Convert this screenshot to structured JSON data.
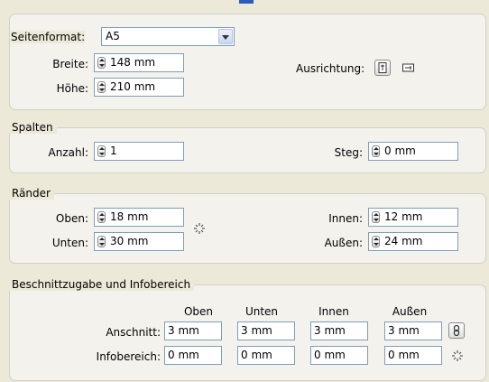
{
  "page_size": {
    "label": "Seitenformat:",
    "value": "A5"
  },
  "width": {
    "label": "Breite:",
    "value": "148 mm"
  },
  "height": {
    "label": "Höhe:",
    "value": "210 mm"
  },
  "orientation": {
    "label": "Ausrichtung:"
  },
  "columns": {
    "legend": "Spalten",
    "count_label": "Anzahl:",
    "count_value": "1",
    "gutter_label": "Steg:",
    "gutter_value": "0 mm"
  },
  "margins": {
    "legend": "Ränder",
    "top_label": "Oben:",
    "top_value": "18 mm",
    "bottom_label": "Unten:",
    "bottom_value": "30 mm",
    "inside_label": "Innen:",
    "inside_value": "12 mm",
    "outside_label": "Außen:",
    "outside_value": "24 mm"
  },
  "bleed": {
    "legend": "Beschnittzugabe und Infobereich",
    "columns": [
      "Oben",
      "Unten",
      "Innen",
      "Außen"
    ],
    "bleed_label": "Anschnitt:",
    "bleed_values": [
      "3 mm",
      "3 mm",
      "3 mm",
      "3 mm"
    ],
    "slug_label": "Infobereich:",
    "slug_values": [
      "0 mm",
      "0 mm",
      "0 mm",
      "0 mm"
    ]
  }
}
